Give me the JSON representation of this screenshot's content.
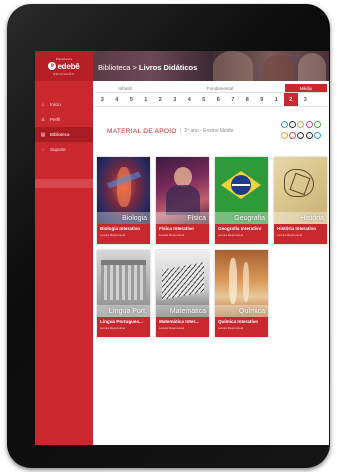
{
  "brand": {
    "top": "Plataforma",
    "name": "edebê",
    "sub": "EDUCAÇÃO"
  },
  "sidebar": {
    "items": [
      {
        "label": "Início",
        "icon": "home-icon",
        "glyph": "⌂"
      },
      {
        "label": "Perfil",
        "icon": "user-icon",
        "glyph": "♙"
      },
      {
        "label": "Biblioteca",
        "icon": "library-icon",
        "glyph": "▤"
      },
      {
        "label": "Suporte",
        "icon": "support-icon",
        "glyph": "◌"
      }
    ]
  },
  "header": {
    "crumb_root": "Biblioteca",
    "crumb_sep": ">",
    "crumb_current": "Livros Didáticos"
  },
  "grades": {
    "groups": [
      "Infantil",
      "Fundamental",
      "Médio"
    ],
    "numbers": [
      "3",
      "4",
      "5",
      "1",
      "2",
      "3",
      "4",
      "5",
      "6",
      "7",
      "8",
      "9",
      "1",
      "2",
      "3"
    ],
    "active_index": 13
  },
  "support": {
    "title": "MATERIAL DE APOIO",
    "separator": "|",
    "subtitle": "2º ano - Ensino Médio"
  },
  "books": [
    {
      "subject": "Biologia",
      "title": "Biologia Interativo",
      "subtitle": "Leitura Reprovável"
    },
    {
      "subject": "Física",
      "title": "Física Interativo",
      "subtitle": "Leitura Reprovável"
    },
    {
      "subject": "Geografia",
      "title": "Geografia Interativo",
      "subtitle": "Leitura Reprovável"
    },
    {
      "subject": "História",
      "title": "História Interativo",
      "subtitle": "Leitura Reprovável"
    },
    {
      "subject": "Língua Port.",
      "title": "Língua Portugues...",
      "subtitle": "Leitura Reprovável"
    },
    {
      "subject": "Matemática",
      "title": "Matemática Inter...",
      "subtitle": "Leitura Reprovável"
    },
    {
      "subject": "Química",
      "title": "Química Interativo",
      "subtitle": "Leitura Reprovável"
    }
  ],
  "colors": {
    "brand_red": "#c9282e",
    "sidebar_dark": "#a91d22"
  }
}
